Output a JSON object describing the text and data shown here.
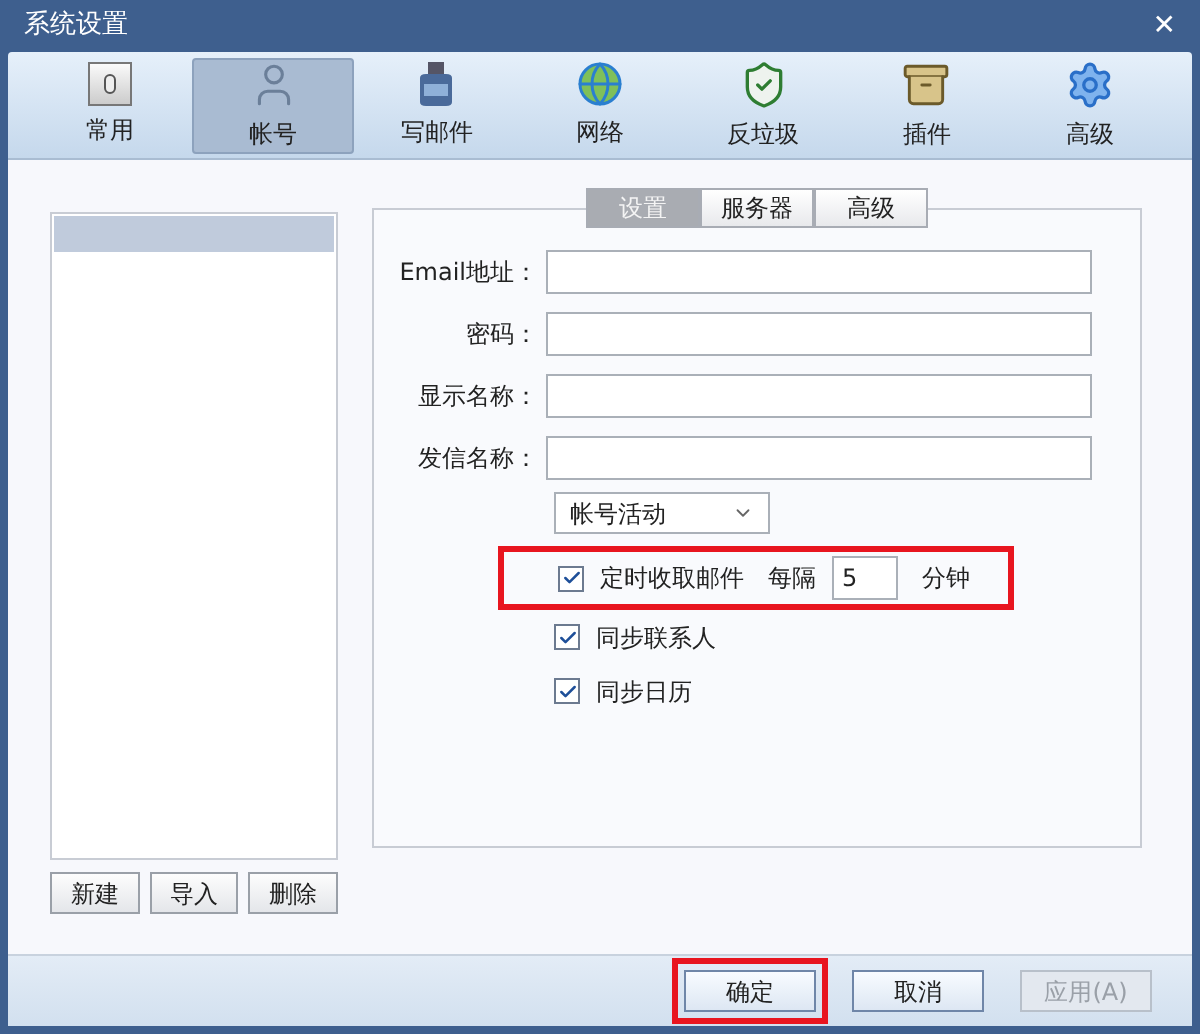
{
  "window": {
    "title": "系统设置",
    "close": "✕"
  },
  "toolbar": [
    {
      "label": "常用",
      "selected": false
    },
    {
      "label": "帐号",
      "selected": true
    },
    {
      "label": "写邮件",
      "selected": false
    },
    {
      "label": "网络",
      "selected": false
    },
    {
      "label": "反垃圾",
      "selected": false
    },
    {
      "label": "插件",
      "selected": false
    },
    {
      "label": "高级",
      "selected": false
    }
  ],
  "accounts": [
    {
      "selected": true
    }
  ],
  "account_buttons": [
    "新建",
    "导入",
    "删除"
  ],
  "tabs": [
    {
      "label": "设置",
      "selected": true
    },
    {
      "label": "服务器",
      "selected": false
    },
    {
      "label": "高级",
      "selected": false
    }
  ],
  "fields": [
    {
      "label": "Email地址："
    },
    {
      "label": "密码："
    },
    {
      "label": "显示名称："
    },
    {
      "label": "发信名称："
    }
  ],
  "dropdown": {
    "value": "帐号活动"
  },
  "timer": {
    "label": "定时收取邮件",
    "checked": true,
    "every": "每隔",
    "value": "5",
    "unit": "分钟",
    "highlighted": true
  },
  "options": [
    {
      "label": "同步联系人",
      "checked": true
    },
    {
      "label": "同步日历",
      "checked": true
    }
  ],
  "footer": [
    {
      "label": "确定",
      "disabled": false,
      "highlighted": true
    },
    {
      "label": "取消",
      "disabled": false,
      "highlighted": false
    },
    {
      "label": "应用(A)",
      "disabled": true,
      "highlighted": false
    }
  ]
}
